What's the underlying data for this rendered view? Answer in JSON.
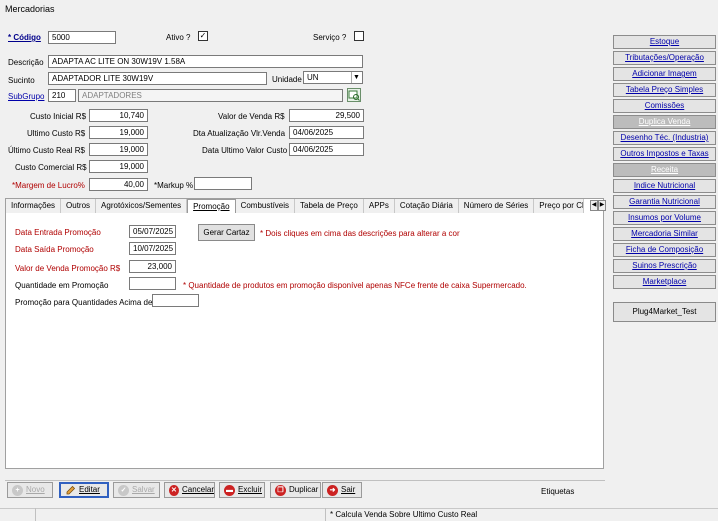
{
  "window": {
    "title": "Mercadorias"
  },
  "header": {
    "codigo_label": "* Código",
    "codigo_value": "5000",
    "ativo_label": "Ativo ?",
    "ativo_mark": "✓",
    "servico_label": "Serviço ?",
    "descricao_label": "Descrição",
    "descricao_value": "ADAPTA AC LITE ON 30W19V 1.58A",
    "sucinto_label": "Sucinto",
    "sucinto_value": "ADAPTADOR LITE 30W19V",
    "unidade_label": "Unidade",
    "unidade_value": "UN",
    "subgrupo_label": "SubGrupo",
    "subgrupo_code": "210",
    "subgrupo_name": "ADAPTADORES"
  },
  "costs": {
    "custo_inicial_label": "Custo Inicial R$",
    "custo_inicial_value": "10,740",
    "ultimo_custo_label": "Ultimo Custo R$",
    "ultimo_custo_value": "19,000",
    "ultimo_custo_real_label": "Último Custo Real R$",
    "ultimo_custo_real_value": "19,000",
    "custo_comercial_label": "Custo Comercial R$",
    "custo_comercial_value": "19,000",
    "margem_label": "*Margem de Lucro%",
    "margem_value": "40,00",
    "markup_label": "*Markup %",
    "markup_value": "",
    "valor_venda_label": "Valor de Venda R$",
    "valor_venda_value": "29,500",
    "dta_atualizacao_label": "Dta Atualização Vlr.Venda",
    "dta_atualizacao_value": "04/06/2025",
    "data_ultimo_custo_label": "Data Ultimo Valor Custo",
    "data_ultimo_custo_value": "04/06/2025"
  },
  "tabs": [
    {
      "label": "Informações"
    },
    {
      "label": "Outros"
    },
    {
      "label": "Agrotóxicos/Sementes"
    },
    {
      "label": "Promoção"
    },
    {
      "label": "Combustíveis"
    },
    {
      "label": "Tabela de Preço"
    },
    {
      "label": "APPs"
    },
    {
      "label": "Cotação Diária"
    },
    {
      "label": "Número de Séries"
    },
    {
      "label": "Preço por Cl"
    }
  ],
  "promocao": {
    "data_entrada_label": "Data Entrada Promoção",
    "data_entrada_value": "05/07/2025",
    "data_saida_label": "Data Saída Promoção",
    "data_saida_value": "10/07/2025",
    "valor_venda_label": "Valor de Venda  Promoção R$",
    "valor_venda_value": "23,000",
    "quantidade_label": "Quantidade em Promoção",
    "quantidade_value": "",
    "promo_qtd_label": "Promoção para Quantidades Acima de",
    "promo_qtd_value": "",
    "gerar_cartaz_label": "Gerar Cartaz",
    "hint_dois_cliques": "* Dois cliques em cima das descrições para alterar a cor",
    "hint_quantidade": "* Quantidade de produtos em promoção disponível apenas NFCe frente de caixa Supermercado."
  },
  "sidebar": {
    "items": [
      {
        "label": "Estoque",
        "enabled": true
      },
      {
        "label": "Tributações/Operação",
        "enabled": true
      },
      {
        "label": "Adicionar Imagem",
        "enabled": true
      },
      {
        "label": "Tabela Preço Simples",
        "enabled": true
      },
      {
        "label": "Comissões",
        "enabled": true
      },
      {
        "label": "Duplica Venda",
        "enabled": false
      },
      {
        "label": "Desenho Téc. (Industria)",
        "enabled": true
      },
      {
        "label": "Outros Impostos e Taxas",
        "enabled": true
      },
      {
        "label": "Receita",
        "enabled": false
      },
      {
        "label": "Indice Nutricional",
        "enabled": true
      },
      {
        "label": "Garantia Nutricional",
        "enabled": true
      },
      {
        "label": "Insumos por Volume",
        "enabled": true
      },
      {
        "label": "Mercadoria Similar",
        "enabled": true
      },
      {
        "label": "Ficha de Composição",
        "enabled": true
      },
      {
        "label": "Suinos Prescrição",
        "enabled": true
      },
      {
        "label": "Marketplace",
        "enabled": true
      }
    ],
    "plug_label": "Plug4Market_Test"
  },
  "toolbar": {
    "novo": "Novo",
    "editar": "Editar",
    "salvar": "Salvar",
    "cancelar": "Cancelar",
    "excluir": "Excluir",
    "duplicar": "Duplicar",
    "sair": "Sair",
    "etiquetas": "Etiquetas"
  },
  "status": {
    "message": "* Calcula Venda Sobre Ultimo Custo  Real"
  },
  "colors": {
    "required_red": "#b00000",
    "link_blue": "#0000aa",
    "panel_bg": "#f0f0f0"
  }
}
